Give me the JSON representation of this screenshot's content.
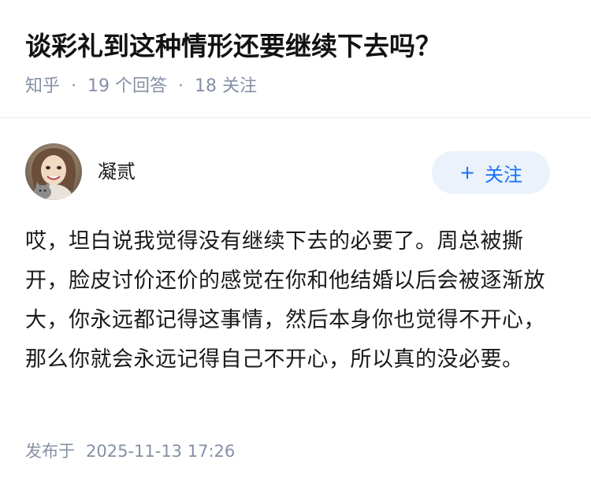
{
  "question": {
    "title": "谈彩礼到这种情形还要继续下去吗？",
    "source": "知乎",
    "separator": "·",
    "answers_count": "19 个回答",
    "followers_count": "18 关注"
  },
  "answer": {
    "author_name": "凝贰",
    "follow_button": {
      "icon": "+",
      "label": "关注"
    },
    "content": "哎，坦白说我觉得没有继续下去的必要了。周总被撕开，脸皮讨价还价的感觉在你和他结婚以后会被逐渐放大，你永远都记得这事情，然后本身你也觉得不开心，那么你就会永远记得自己不开心，所以真的没必要。",
    "published_prefix": "发布于",
    "published_time": "2025-11-13 17:26"
  },
  "colors": {
    "title": "#121212",
    "meta": "#8590a6",
    "follow_bg": "#ebf2fb",
    "follow_text": "#1772f6"
  }
}
